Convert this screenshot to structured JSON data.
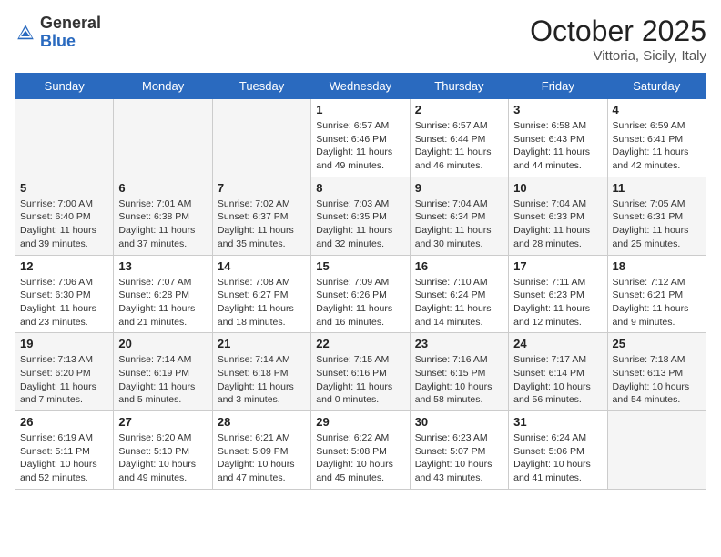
{
  "header": {
    "logo_general": "General",
    "logo_blue": "Blue",
    "month_title": "October 2025",
    "location": "Vittoria, Sicily, Italy"
  },
  "days_of_week": [
    "Sunday",
    "Monday",
    "Tuesday",
    "Wednesday",
    "Thursday",
    "Friday",
    "Saturday"
  ],
  "weeks": [
    [
      {
        "day": "",
        "info": ""
      },
      {
        "day": "",
        "info": ""
      },
      {
        "day": "",
        "info": ""
      },
      {
        "day": "1",
        "info": "Sunrise: 6:57 AM\nSunset: 6:46 PM\nDaylight: 11 hours\nand 49 minutes."
      },
      {
        "day": "2",
        "info": "Sunrise: 6:57 AM\nSunset: 6:44 PM\nDaylight: 11 hours\nand 46 minutes."
      },
      {
        "day": "3",
        "info": "Sunrise: 6:58 AM\nSunset: 6:43 PM\nDaylight: 11 hours\nand 44 minutes."
      },
      {
        "day": "4",
        "info": "Sunrise: 6:59 AM\nSunset: 6:41 PM\nDaylight: 11 hours\nand 42 minutes."
      }
    ],
    [
      {
        "day": "5",
        "info": "Sunrise: 7:00 AM\nSunset: 6:40 PM\nDaylight: 11 hours\nand 39 minutes."
      },
      {
        "day": "6",
        "info": "Sunrise: 7:01 AM\nSunset: 6:38 PM\nDaylight: 11 hours\nand 37 minutes."
      },
      {
        "day": "7",
        "info": "Sunrise: 7:02 AM\nSunset: 6:37 PM\nDaylight: 11 hours\nand 35 minutes."
      },
      {
        "day": "8",
        "info": "Sunrise: 7:03 AM\nSunset: 6:35 PM\nDaylight: 11 hours\nand 32 minutes."
      },
      {
        "day": "9",
        "info": "Sunrise: 7:04 AM\nSunset: 6:34 PM\nDaylight: 11 hours\nand 30 minutes."
      },
      {
        "day": "10",
        "info": "Sunrise: 7:04 AM\nSunset: 6:33 PM\nDaylight: 11 hours\nand 28 minutes."
      },
      {
        "day": "11",
        "info": "Sunrise: 7:05 AM\nSunset: 6:31 PM\nDaylight: 11 hours\nand 25 minutes."
      }
    ],
    [
      {
        "day": "12",
        "info": "Sunrise: 7:06 AM\nSunset: 6:30 PM\nDaylight: 11 hours\nand 23 minutes."
      },
      {
        "day": "13",
        "info": "Sunrise: 7:07 AM\nSunset: 6:28 PM\nDaylight: 11 hours\nand 21 minutes."
      },
      {
        "day": "14",
        "info": "Sunrise: 7:08 AM\nSunset: 6:27 PM\nDaylight: 11 hours\nand 18 minutes."
      },
      {
        "day": "15",
        "info": "Sunrise: 7:09 AM\nSunset: 6:26 PM\nDaylight: 11 hours\nand 16 minutes."
      },
      {
        "day": "16",
        "info": "Sunrise: 7:10 AM\nSunset: 6:24 PM\nDaylight: 11 hours\nand 14 minutes."
      },
      {
        "day": "17",
        "info": "Sunrise: 7:11 AM\nSunset: 6:23 PM\nDaylight: 11 hours\nand 12 minutes."
      },
      {
        "day": "18",
        "info": "Sunrise: 7:12 AM\nSunset: 6:21 PM\nDaylight: 11 hours\nand 9 minutes."
      }
    ],
    [
      {
        "day": "19",
        "info": "Sunrise: 7:13 AM\nSunset: 6:20 PM\nDaylight: 11 hours\nand 7 minutes."
      },
      {
        "day": "20",
        "info": "Sunrise: 7:14 AM\nSunset: 6:19 PM\nDaylight: 11 hours\nand 5 minutes."
      },
      {
        "day": "21",
        "info": "Sunrise: 7:14 AM\nSunset: 6:18 PM\nDaylight: 11 hours\nand 3 minutes."
      },
      {
        "day": "22",
        "info": "Sunrise: 7:15 AM\nSunset: 6:16 PM\nDaylight: 11 hours\nand 0 minutes."
      },
      {
        "day": "23",
        "info": "Sunrise: 7:16 AM\nSunset: 6:15 PM\nDaylight: 10 hours\nand 58 minutes."
      },
      {
        "day": "24",
        "info": "Sunrise: 7:17 AM\nSunset: 6:14 PM\nDaylight: 10 hours\nand 56 minutes."
      },
      {
        "day": "25",
        "info": "Sunrise: 7:18 AM\nSunset: 6:13 PM\nDaylight: 10 hours\nand 54 minutes."
      }
    ],
    [
      {
        "day": "26",
        "info": "Sunrise: 6:19 AM\nSunset: 5:11 PM\nDaylight: 10 hours\nand 52 minutes."
      },
      {
        "day": "27",
        "info": "Sunrise: 6:20 AM\nSunset: 5:10 PM\nDaylight: 10 hours\nand 49 minutes."
      },
      {
        "day": "28",
        "info": "Sunrise: 6:21 AM\nSunset: 5:09 PM\nDaylight: 10 hours\nand 47 minutes."
      },
      {
        "day": "29",
        "info": "Sunrise: 6:22 AM\nSunset: 5:08 PM\nDaylight: 10 hours\nand 45 minutes."
      },
      {
        "day": "30",
        "info": "Sunrise: 6:23 AM\nSunset: 5:07 PM\nDaylight: 10 hours\nand 43 minutes."
      },
      {
        "day": "31",
        "info": "Sunrise: 6:24 AM\nSunset: 5:06 PM\nDaylight: 10 hours\nand 41 minutes."
      },
      {
        "day": "",
        "info": ""
      }
    ]
  ]
}
